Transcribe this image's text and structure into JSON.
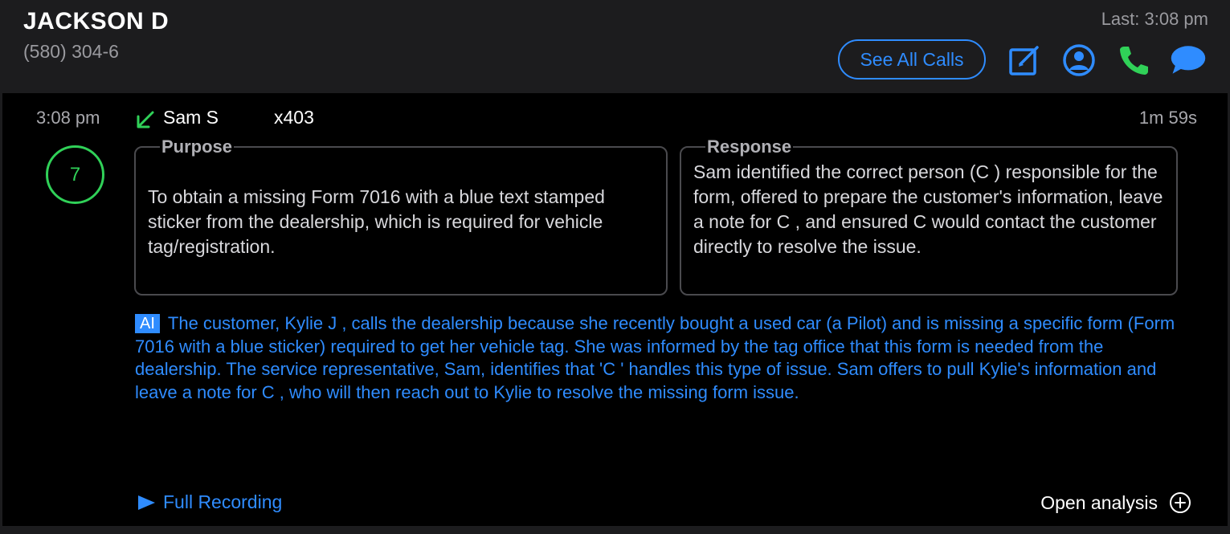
{
  "header": {
    "contact_name": "JACKSON D",
    "contact_phone": "(580) 304-6",
    "last_call": "Last: 3:08 pm",
    "see_all_label": "See All Calls",
    "icons": [
      "compose-icon",
      "profile-icon",
      "phone-icon",
      "message-icon"
    ]
  },
  "call": {
    "time": "3:08 pm",
    "agent_name": "Sam S",
    "agent_ext": "x403",
    "duration": "1m 59s",
    "score": "7"
  },
  "purpose": {
    "title": "Purpose",
    "text": "To obtain a missing Form 7016 with a blue text stamped sticker from the dealership, which is required for vehicle tag/registration."
  },
  "response": {
    "title": "Response",
    "text": "Sam identified the correct person (C        ) responsible for the form, offered to prepare the customer's information, leave a note for C        , and ensured C         would contact the customer directly to resolve the issue."
  },
  "ai": {
    "badge": "AI",
    "summary": "The customer, Kylie J           , calls the dealership because she recently bought a used car (a Pilot) and is missing a specific form (Form 7016 with a blue sticker) required to get her vehicle tag. She was informed by the tag office that this form is needed from the dealership. The service representative, Sam, identifies that 'C        ' handles this type of issue. Sam offers to pull Kylie's information and leave a note for C         , who will then reach out to Kylie to resolve the missing form issue."
  },
  "footer": {
    "full_recording_label": "Full Recording",
    "open_analysis_label": "Open analysis"
  },
  "colors": {
    "accent_blue": "#2f8cff",
    "green": "#30d158",
    "header_bg": "#1c1c1e"
  }
}
